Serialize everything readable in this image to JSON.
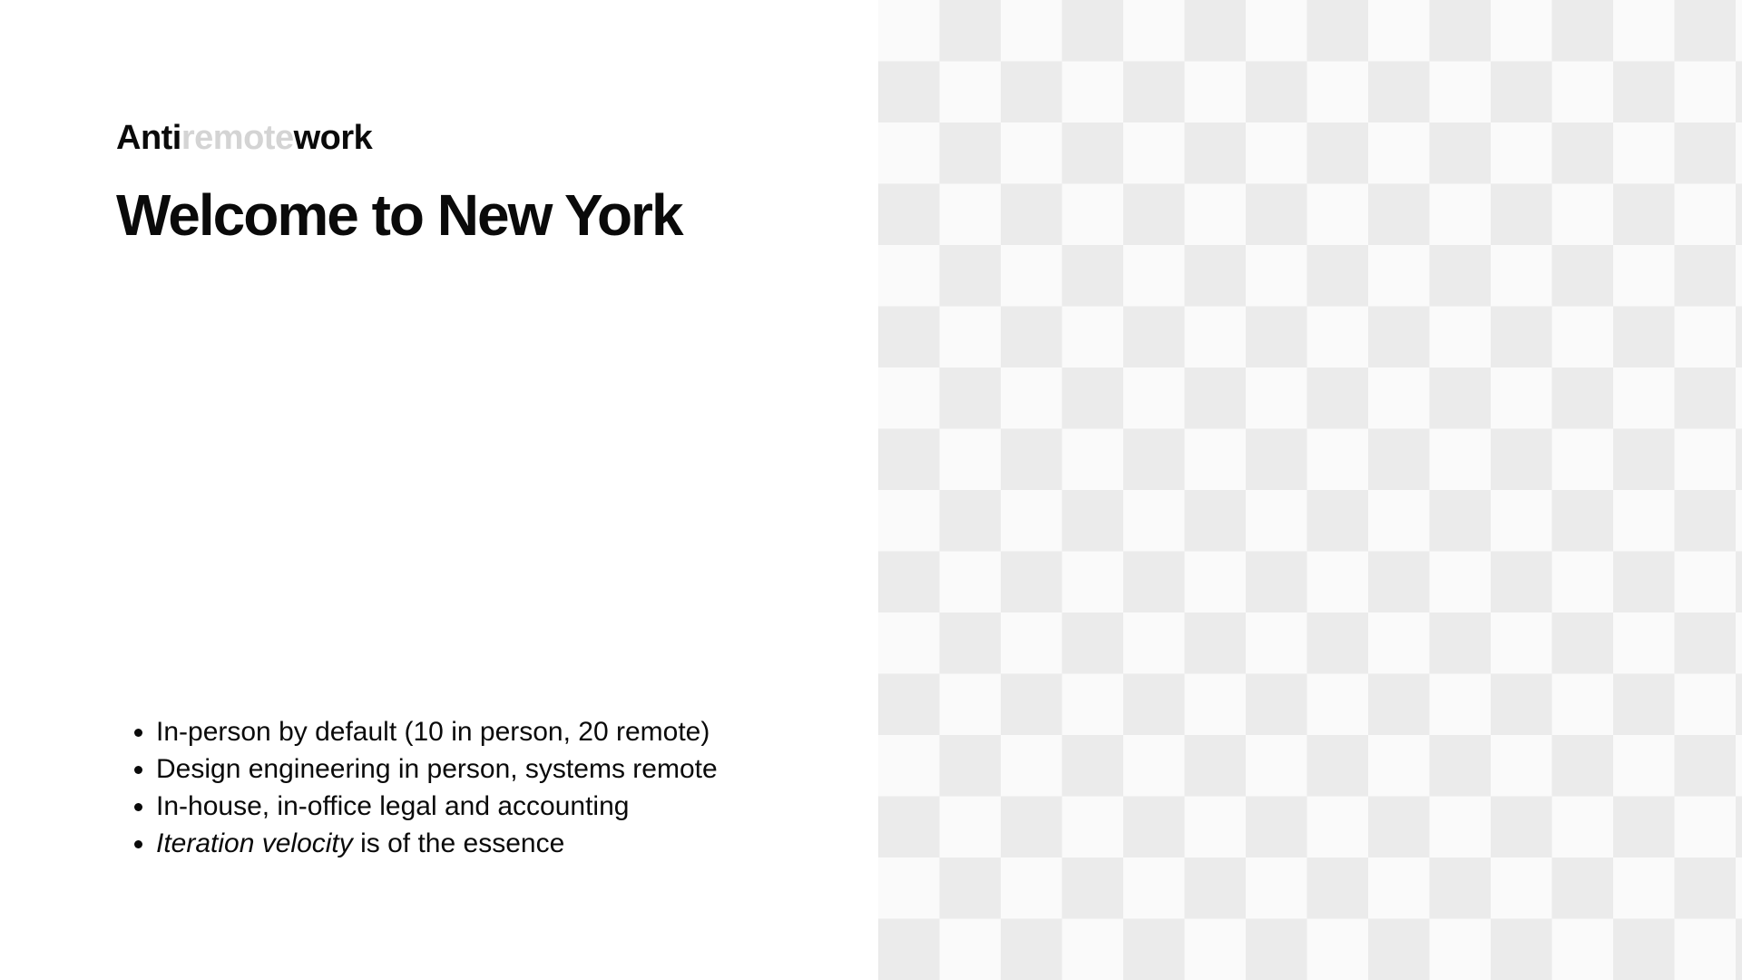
{
  "brand": {
    "part1": "Anti",
    "part2": "remote",
    "part3": "work"
  },
  "slide": {
    "title": "Welcome to New York",
    "bullets": [
      "In-person by default (10 in person, 20 remote)",
      "Design engineering in person, systems remote",
      "In-house, in-office legal and accounting"
    ],
    "last_bullet": {
      "emphasis": "Iteration velocity",
      "rest": " is of the essence"
    }
  },
  "colors": {
    "text": "#0a0a0a",
    "brand_muted": "#d4d4d4",
    "checker_light": "#fafafa",
    "checker_dark": "#ebebeb"
  }
}
